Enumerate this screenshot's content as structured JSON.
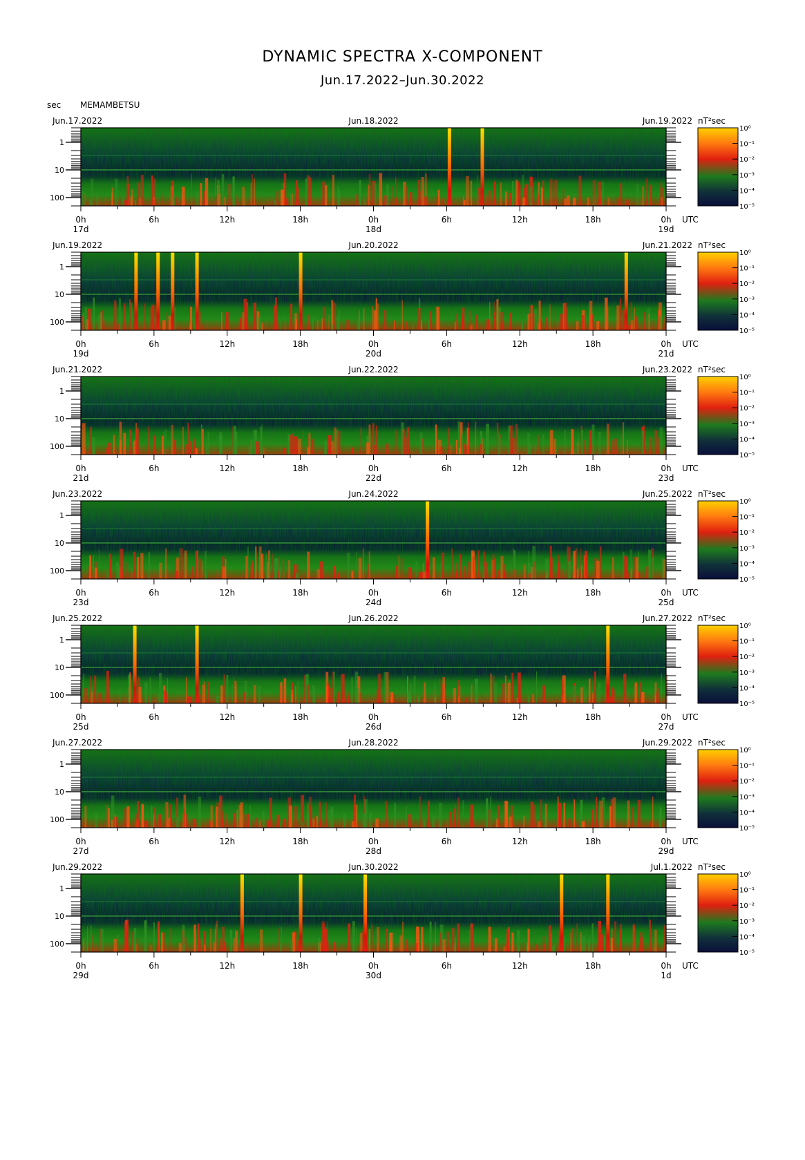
{
  "title": "DYNAMIC SPECTRA X-COMPONENT",
  "subtitle": "Jun.17.2022–Jun.30.2022",
  "y_unit": "sec",
  "station": "MEMAMBETSU",
  "colorbar": {
    "unit": "nT²sec",
    "labels": [
      "10⁰",
      "10⁻¹",
      "10⁻²",
      "10⁻³",
      "10⁻⁴",
      "10⁻⁵"
    ]
  },
  "chart_data": {
    "type": "heatmap",
    "y_axis": {
      "label": "sec",
      "scale": "log",
      "ticks": [
        "1",
        "10",
        "100"
      ]
    },
    "x_ticks": [
      "0h",
      "6h",
      "12h",
      "18h",
      "0h",
      "6h",
      "12h",
      "18h",
      "0h"
    ],
    "x_axis_end_label": "UTC",
    "color_scale": {
      "unit": "nT²sec",
      "range": [
        "10⁻⁵",
        "10⁰"
      ],
      "colors": [
        "#0a0f3a",
        "#1e7a1e",
        "#e02010",
        "#ffd000"
      ]
    },
    "panels": [
      {
        "dates": [
          "Jun.17.2022",
          "Jun.18.2022",
          "Jun.19.2022"
        ],
        "day_labels": [
          "17d",
          "18d",
          "19d"
        ],
        "events_h": [
          30.2,
          32.9
        ]
      },
      {
        "dates": [
          "Jun.19.2022",
          "Jun.20.2022",
          "Jun.21.2022"
        ],
        "day_labels": [
          "19d",
          "20d",
          "21d"
        ],
        "events_h": [
          4.5,
          6.3,
          7.5,
          9.5,
          18.0,
          44.7
        ]
      },
      {
        "dates": [
          "Jun.21.2022",
          "Jun.22.2022",
          "Jun.23.2022"
        ],
        "day_labels": [
          "21d",
          "22d",
          "23d"
        ],
        "events_h": []
      },
      {
        "dates": [
          "Jun.23.2022",
          "Jun.24.2022",
          "Jun.25.2022"
        ],
        "day_labels": [
          "23d",
          "24d",
          "25d"
        ],
        "events_h": [
          28.4
        ]
      },
      {
        "dates": [
          "Jun.25.2022",
          "Jun.26.2022",
          "Jun.27.2022"
        ],
        "day_labels": [
          "25d",
          "26d",
          "27d"
        ],
        "events_h": [
          4.4,
          9.5,
          43.2
        ]
      },
      {
        "dates": [
          "Jun.27.2022",
          "Jun.28.2022",
          "Jun.29.2022"
        ],
        "day_labels": [
          "27d",
          "28d",
          "29d"
        ],
        "events_h": []
      },
      {
        "dates": [
          "Jun.29.2022",
          "Jun.30.2022",
          "Jul.1.2022"
        ],
        "day_labels": [
          "29d",
          "30d",
          "1d"
        ],
        "events_h": [
          13.2,
          18.0,
          23.3,
          39.4,
          43.2
        ]
      }
    ]
  }
}
